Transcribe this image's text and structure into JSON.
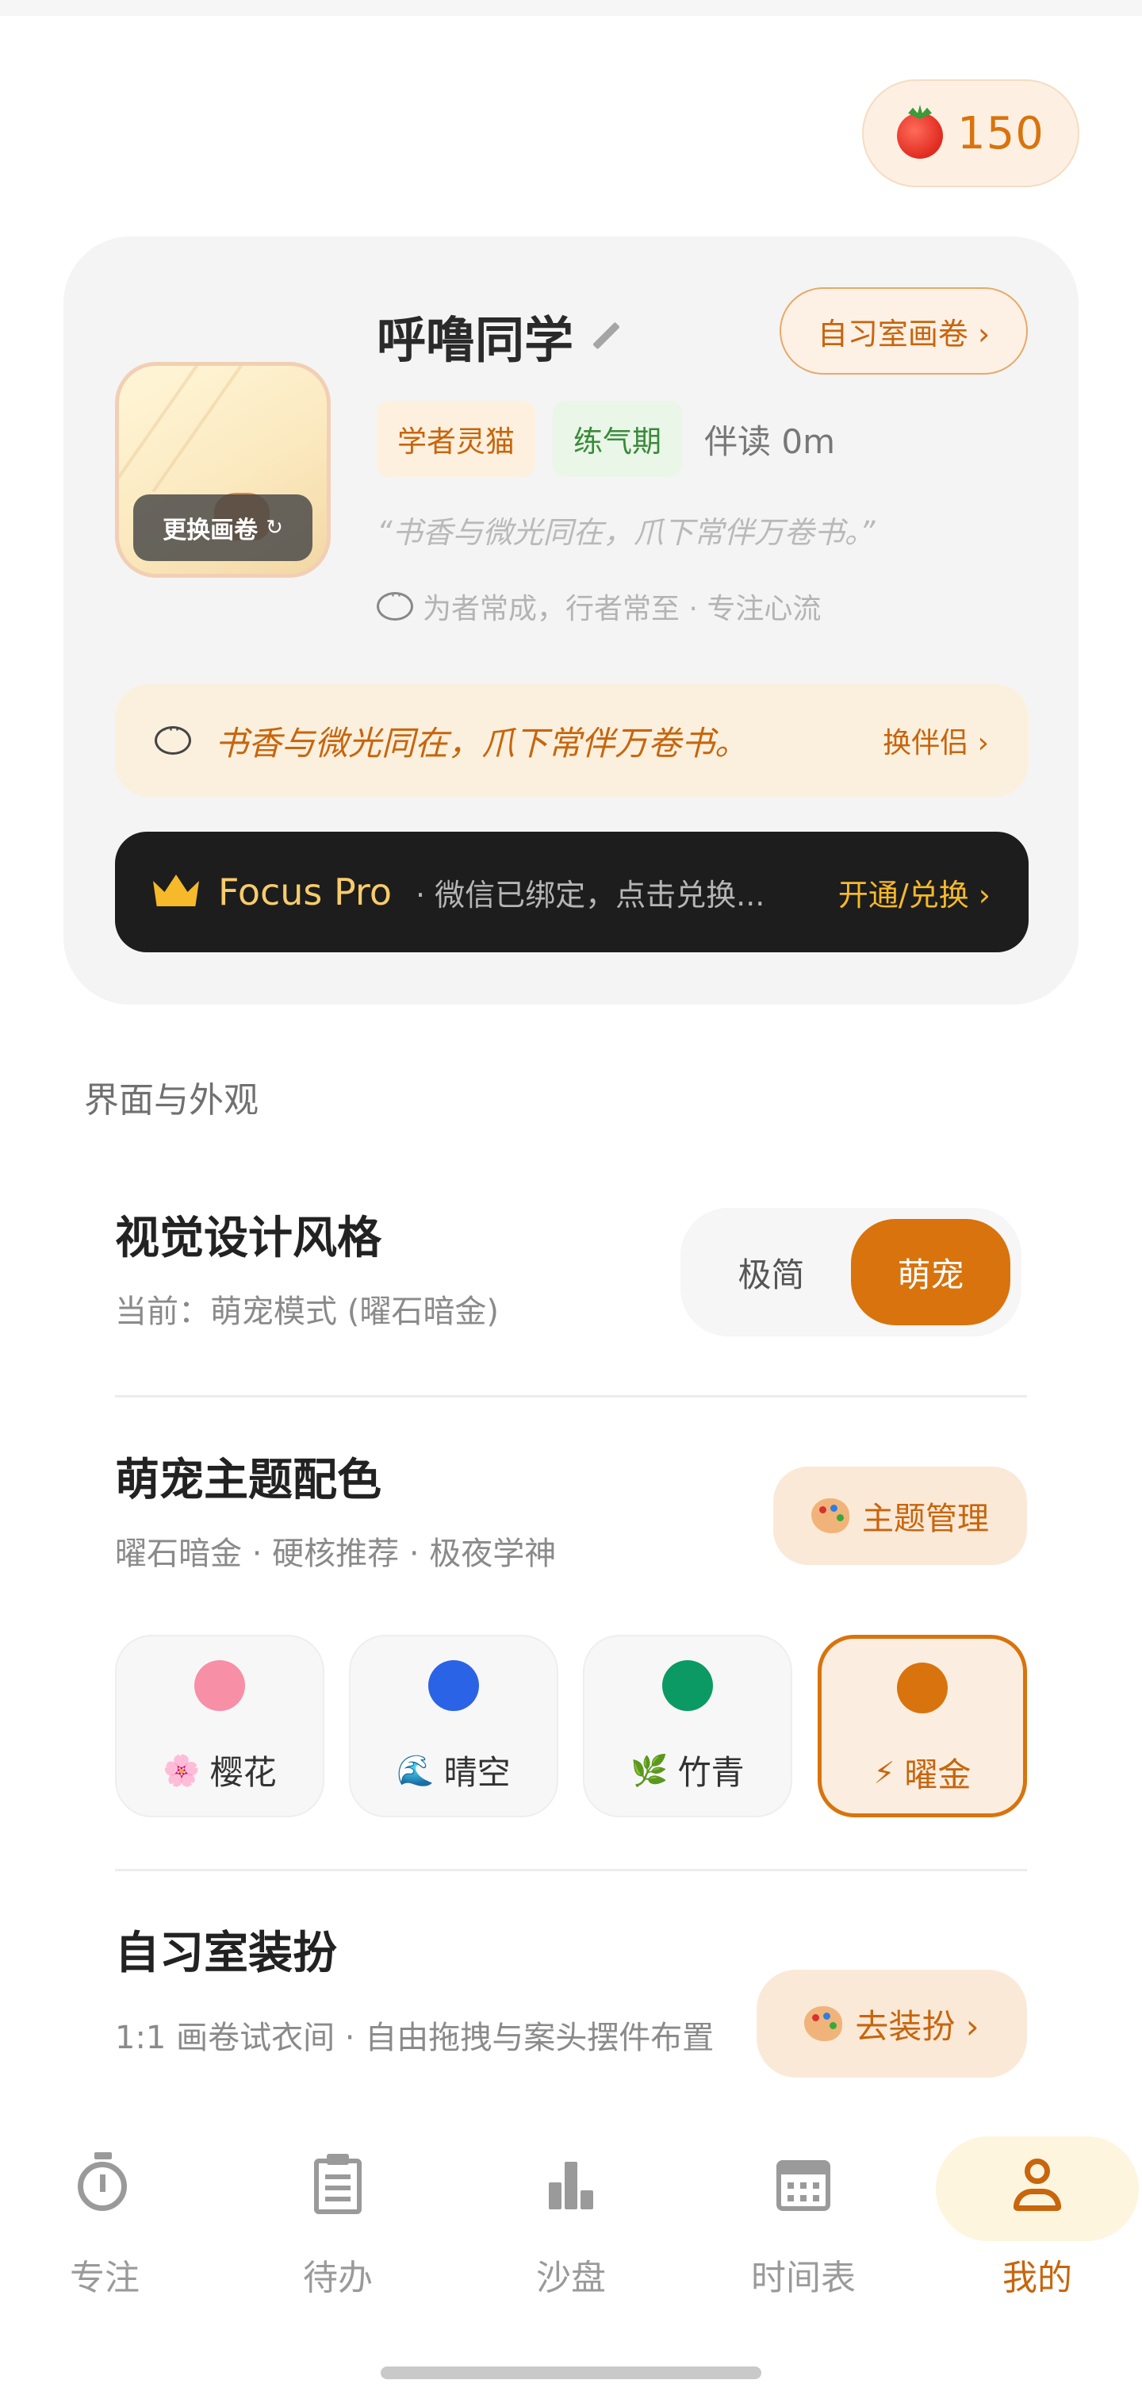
{
  "tomato": {
    "count": "150",
    "icon": "tomato-icon"
  },
  "profile": {
    "name": "呼噜同学",
    "avatar_button": "更换画卷",
    "gallery_button": "自习室画卷 ›",
    "tags": [
      "学者灵猫",
      "练气期"
    ],
    "companion_time": "伴读 0m",
    "quote": "“书香与微光同在，爪下常伴万卷书。”",
    "motto": "为者常成，行者常至 · 专注心流",
    "companion_line": "书香与微光同在，爪下常伴万卷书。",
    "companion_action": "换伴侣 ›"
  },
  "pro": {
    "title": "Focus Pro",
    "subtitle": "· 微信已绑定，点击兑换...",
    "action": "开通/兑换 ›"
  },
  "appearance": {
    "section_title": "界面与外观",
    "style": {
      "title": "视觉设计风格",
      "subtitle": "当前：萌宠模式 (曜石暗金)",
      "options": [
        "极简",
        "萌宠"
      ],
      "selected": "萌宠"
    },
    "theme": {
      "title": "萌宠主题配色",
      "subtitle": "曜石暗金 · 硬核推荐 · 极夜学神",
      "manage_button": "主题管理",
      "swatches": [
        {
          "glyph": "🌸",
          "label": "樱花",
          "color": "#f78fa6"
        },
        {
          "glyph": "🌊",
          "label": "晴空",
          "color": "#2b63e6"
        },
        {
          "glyph": "🌿",
          "label": "竹青",
          "color": "#0b9a63"
        },
        {
          "glyph": "⚡",
          "label": "曜金",
          "color": "#d9730d"
        }
      ],
      "selected": "曜金"
    },
    "dress": {
      "title": "自习室装扮",
      "subtitle": "1:1 画卷试衣间 · 自由拖拽与案头摆件布置",
      "button": "去装扮 ›"
    }
  },
  "nav": {
    "items": [
      "专注",
      "待办",
      "沙盘",
      "时间表",
      "我的"
    ],
    "active": "我的"
  },
  "colors": {
    "accent": "#d9730d",
    "accent_text": "#c8650d",
    "pro_bg": "#1d1d1d",
    "card_bg": "#f4f4f4"
  }
}
